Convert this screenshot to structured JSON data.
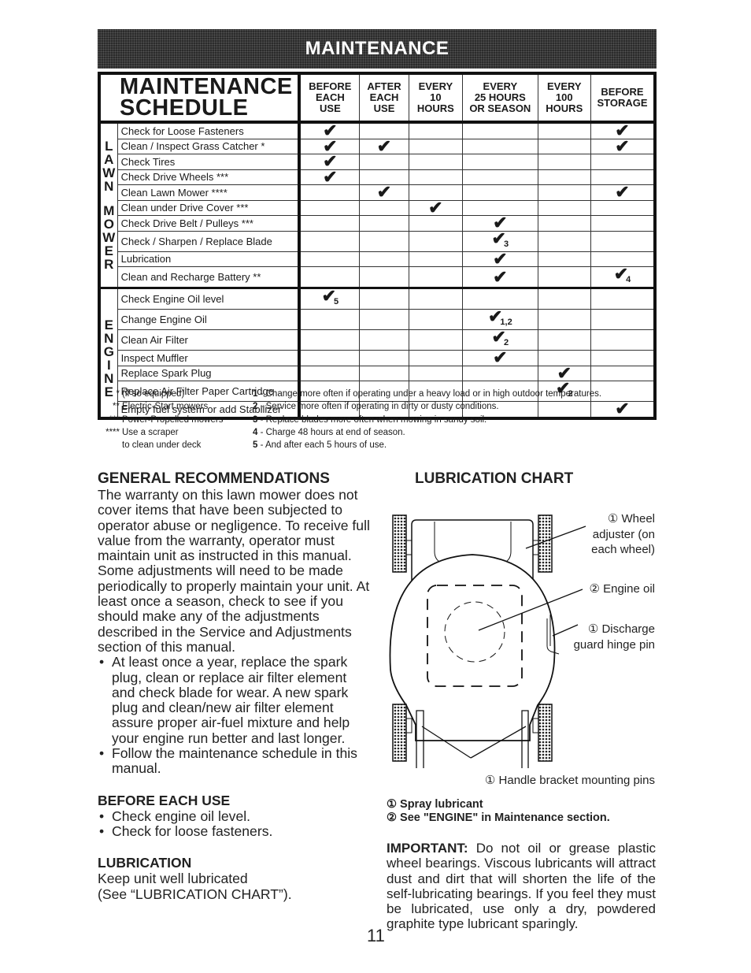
{
  "banner": "MAINTENANCE",
  "schedule": {
    "title_line1": "MAINTENANCE",
    "title_line2": "SCHEDULE",
    "columns": [
      [
        "BEFORE",
        "EACH",
        "USE"
      ],
      [
        "AFTER",
        "EACH",
        "USE"
      ],
      [
        "EVERY",
        "10",
        "HOURS"
      ],
      [
        "EVERY",
        "25 HOURS",
        "OR SEASON"
      ],
      [
        "EVERY",
        "100",
        "HOURS"
      ],
      [
        "BEFORE",
        "STORAGE"
      ]
    ],
    "sections": [
      {
        "label": "LAWN MOWER",
        "letters": [
          "L",
          "A",
          "W",
          "N",
          "",
          "M",
          "O",
          "W",
          "E",
          "R"
        ],
        "rows": [
          {
            "task": "Check for Loose Fasteners",
            "marks": [
              "✔",
              "",
              "",
              "",
              "",
              "✔"
            ]
          },
          {
            "task": "Clean / Inspect Grass Catcher *",
            "marks": [
              "✔",
              "✔",
              "",
              "",
              "",
              "✔"
            ]
          },
          {
            "task": "Check Tires",
            "marks": [
              "✔",
              "",
              "",
              "",
              "",
              ""
            ]
          },
          {
            "task": "Check Drive Wheels ***",
            "marks": [
              "✔",
              "",
              "",
              "",
              "",
              ""
            ]
          },
          {
            "task": "Clean Lawn Mower ****",
            "marks": [
              "",
              "✔",
              "",
              "",
              "",
              "✔"
            ]
          },
          {
            "task": "Clean under Drive Cover ***",
            "marks": [
              "",
              "",
              "✔",
              "",
              "",
              ""
            ]
          },
          {
            "task": "Check Drive Belt / Pulleys ***",
            "marks": [
              "",
              "",
              "",
              "✔",
              "",
              ""
            ]
          },
          {
            "task": "Check / Sharpen / Replace Blade",
            "marks": [
              "",
              "",
              "",
              "✔3",
              "",
              ""
            ]
          },
          {
            "task": "Lubrication",
            "marks": [
              "",
              "",
              "",
              "✔",
              "",
              ""
            ]
          },
          {
            "task": "Clean and Recharge Battery **",
            "marks": [
              "",
              "",
              "",
              "✔",
              "",
              "✔4"
            ]
          }
        ]
      },
      {
        "label": "ENGINE",
        "letters": [
          "",
          "E",
          "N",
          "G",
          "I",
          "N",
          "E"
        ],
        "rows": [
          {
            "task": "Check Engine Oil level",
            "marks": [
              "✔5",
              "",
              "",
              "",
              "",
              ""
            ]
          },
          {
            "task": "Change Engine Oil",
            "marks": [
              "",
              "",
              "",
              "✔1,2",
              "",
              ""
            ]
          },
          {
            "task": "Clean Air Filter",
            "marks": [
              "",
              "",
              "",
              "✔2",
              "",
              ""
            ]
          },
          {
            "task": "Inspect Muffler",
            "marks": [
              "",
              "",
              "",
              "✔",
              "",
              ""
            ]
          },
          {
            "task": "Replace Spark Plug",
            "marks": [
              "",
              "",
              "",
              "",
              "✔",
              ""
            ]
          },
          {
            "task": "Replace Air Filter Paper Cartridge",
            "marks": [
              "",
              "",
              "",
              "",
              "✔2",
              ""
            ]
          },
          {
            "task": "Empty fuel system or add Stabilizer",
            "marks": [
              "",
              "",
              "",
              "",
              "",
              "✔"
            ]
          }
        ]
      }
    ]
  },
  "footnotes": {
    "symbols": [
      {
        "mark": "*",
        "text": "(if so equipped)"
      },
      {
        "mark": "**",
        "text": "Electric-Start mowers"
      },
      {
        "mark": "***",
        "text": "Power-Propelled mowers"
      },
      {
        "mark": "****",
        "text": "Use a scraper"
      },
      {
        "mark": "",
        "text": "to clean under deck"
      }
    ],
    "numbered": [
      {
        "num": "1",
        "text": " - Change more often if operating under a heavy load or in high outdoor temperatures."
      },
      {
        "num": "2",
        "text": " - Service more often if operating in dirty or dusty conditions."
      },
      {
        "num": "3",
        "text": " - Replace blades more often when mowing in sandy soil."
      },
      {
        "num": "4",
        "text": " - Charge 48 hours at end of season."
      },
      {
        "num": "5",
        "text": " - And after each 5 hours of use."
      }
    ]
  },
  "general": {
    "heading": "GENERAL RECOMMENDATIONS",
    "paragraph": "The warranty on this lawn mower does not cover items that have been subjected to operator abuse or negligence.  To receive full value from the warranty, operator must maintain unit as instructed in this manual. Some adjustments will need to be made periodically to properly maintain your unit. At least once a season, check to see if you should make any of the adjustments described in the Service and Adjustments section of this manual.",
    "bullets": [
      "At least once a year, replace the spark plug, clean or replace air filter element and check blade for wear.  A new spark plug and clean/new air filter element assure proper air-fuel mixture and help your engine run better and last longer.",
      "Follow the maintenance schedule in this manual."
    ]
  },
  "before_each_use": {
    "heading": "BEFORE EACH USE",
    "bullets": [
      "Check engine oil level.",
      "Check for loose fasteners."
    ]
  },
  "lubrication": {
    "heading": "LUBRICATION",
    "line1": "Keep unit well lubricated",
    "line2": "(See “LUBRICATION CHART”)."
  },
  "lub_chart": {
    "title": "LUBRICATION CHART",
    "callouts": {
      "wheel": [
        "① Wheel",
        "adjuster (on",
        "each wheel)"
      ],
      "engine": "② Engine oil",
      "discharge": [
        "① Discharge",
        "guard hinge pin"
      ],
      "handle": "① Handle bracket mounting pins"
    },
    "legend": [
      "① Spray lubricant",
      "② See \"ENGINE\" in Maintenance section."
    ]
  },
  "important": {
    "label": "IMPORTANT:",
    "text": "  Do not oil or grease plastic wheel bearings.  Viscous lubricants will attract dust and dirt that will shorten the life of the self-lubricating bearings.  If you feel they must be lubricated, use only a dry, powdered graphite type lubricant sparingly."
  },
  "page_number": "11"
}
